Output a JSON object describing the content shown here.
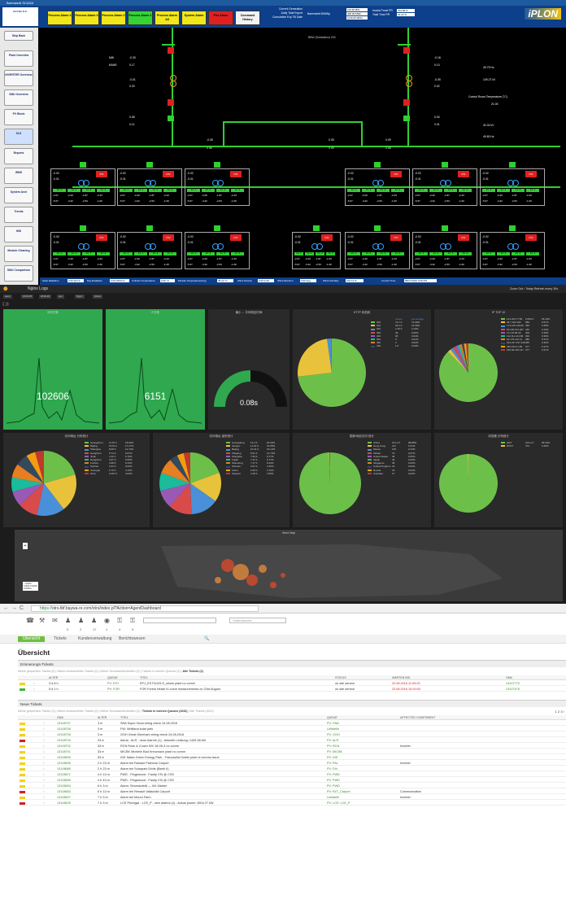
{
  "scada": {
    "title": "Barmstedt SCADA",
    "logo_text": "BAYWA R.E.",
    "alarms": [
      {
        "label": "Process Alarm 4",
        "color": "#f2e61a"
      },
      {
        "label": "Process Alarm 3",
        "color": "#f2e61a"
      },
      {
        "label": "Process Alarm 2",
        "color": "#f2e61a"
      },
      {
        "label": "Process Alarm 1",
        "color": "#35d435"
      },
      {
        "label": "Process Alarm All",
        "color": "#f2e61a"
      },
      {
        "label": "System Alarm",
        "color": "#f2e61a"
      },
      {
        "label": "Fire Alarm",
        "color": "#e02020"
      },
      {
        "label": "Command History",
        "color": "#f2f2f2"
      }
    ],
    "top_info": {
      "l1": "Current Generation",
      "l2": "Daily Total Export",
      "l3": "Cumulative Exp Till Date",
      "mid_label": "Barmstedt 50MWp",
      "f1": "119.48 MW",
      "f2": "468.09 MWh",
      "f3": "1016.05 MWh",
      "r1": "Irradia Panel PR",
      "r2": "Total Time PR",
      "rf1": "794.68 %",
      "rf2": "91.22 %"
    },
    "brand": "iPLON",
    "sidebar": [
      "Skip Back",
      "Plant Overview",
      "INVERTER Overview",
      "SMU Overview",
      "PV Block",
      "SLD",
      "Reports",
      "WMS",
      "System Arch",
      "Trends",
      "MIS",
      "Module Cleaning",
      "SMU Comparison"
    ],
    "feeder": "BBW (Substation) 033",
    "readings": {
      "mw1": "MW",
      "mvar1": "MVAR",
      "v1": "-0.30",
      "v2": "0.17",
      "v3": "-0.01",
      "v4": "0.20",
      "v5": "0.08",
      "v6": "0.11",
      "r1": "-0.18",
      "r2": "0.13",
      "r3": "-0.05",
      "r4": "0.02",
      "r5": "0.00",
      "r6": "0.01",
      "hz1": "49.79 Hz",
      "kv1": "109.27 kV",
      "room": "Control Room Temperature (°C)",
      "roomv": "21.00",
      "kv2": "32.02 kV",
      "hz2": "49.80 Hz",
      "b1": "-0.05",
      "b2": "0.06",
      "b3": "0.05",
      "b4": "0.09",
      "b5": "0.09",
      "b6": "0.06"
    },
    "block": {
      "mw": "-0.02",
      "mvar": "-0.01",
      "btn": "INV",
      "s1": "Inv -1",
      "s2": "Inv -2",
      "s3": "Inv -3",
      "s4": "Inv -4",
      "r1": [
        "-2.07",
        "-2.20",
        "-1.87",
        "-2.43"
      ],
      "r2": [
        "-5.67",
        "-4.32",
        "-2.53",
        "-1.00"
      ],
      "kw": "kW",
      "kvar": "kVAR"
    },
    "bottom": {
      "l1": "Solar Radiation",
      "f1": "0.00 W/m2",
      "l2": "Day Radiation",
      "f2": "0.00 kWh/m2",
      "l3": "Ambient Temperature",
      "f3": "0.00 °C",
      "l4": "Module Temperature(Avg)",
      "f4": "35.22 °C",
      "l5": "Wind Velocity",
      "f5": "0.00 km/h",
      "l6": "Wind Direction",
      "f6": "0.00 deg",
      "l7": "Wind Humidity",
      "f7": "100.12 %",
      "l8": "Current Time",
      "f8": "08/27/2016 3:09 PM"
    }
  },
  "kibana": {
    "app": "Nginx Logs",
    "top_right": "Zoom Out  ›  Today  Refresh every 30s",
    "filters": [
      "www",
      "2016-08",
      "2016-09",
      "ups",
      "Nginx",
      "Active"
    ],
    "section": "汇总",
    "panels": [
      {
        "title": "请求总数",
        "value": "102606"
      },
      {
        "title": "IP总数",
        "value": "6151"
      },
      {
        "title": "最小 ... 平均响应时间",
        "value": "0.08s"
      },
      {
        "title": "HTTP 状态码"
      },
      {
        "title": "IP TOP 10"
      },
      {
        "title": "访问地址 分布统计"
      },
      {
        "title": "访问地址 省份统计"
      },
      {
        "title": "国家/地区访问 统计"
      },
      {
        "title": "浏览器 分布统计"
      },
      {
        "title": "Word Map"
      }
    ],
    "status_legend": {
      "head": [
        "values",
        "percentage"
      ],
      "rows": [
        [
          "200",
          "74.7 K",
          "72.99%"
        ],
        [
          "304",
          "25.2 K",
          "24.59%"
        ],
        [
          "302",
          "2.15 K",
          "2.10%"
        ],
        [
          "499",
          "49",
          "0.05%"
        ],
        [
          "404",
          "36",
          "0.04%"
        ],
        [
          "502",
          "9",
          "0.01%"
        ],
        [
          "499",
          "3",
          "0.00%"
        ],
        [
          "429",
          "1.5",
          "0.00%"
        ]
      ]
    },
    "ip_legend": {
      "rows": [
        [
          "121.224.77.83",
          "2,693 K",
          "26.44%"
        ],
        [
          "36.7.193.182",
          "586",
          "0.57%"
        ],
        [
          "174.145.146.83",
          "490",
          "0.48%"
        ],
        [
          "60.220.131.407",
          "440",
          "0.43%"
        ],
        [
          "171.15.85.36",
          "400",
          "0.39%"
        ],
        [
          "112.111.124.68",
          "394",
          "0.38%"
        ],
        [
          "61.175.110.74",
          "380",
          "0.37%"
        ],
        [
          "222.237.197.248",
          "365",
          "0.36%"
        ],
        [
          "220.194.4.109",
          "377",
          "0.37%"
        ],
        [
          "183.69.135.127",
          "377",
          "0.37%"
        ]
      ]
    },
    "city_legend": {
      "rows": [
        [
          "Guangzhou",
          "11.97 k",
          "18.92%"
        ],
        [
          "Beijing",
          "10.91 k",
          "17.27%"
        ],
        [
          "Shanghai",
          "8.05 K",
          "12.74%"
        ],
        [
          "Hangzhou",
          "5.74 K",
          "9.07%"
        ],
        [
          "Jinan",
          "4.11 K",
          "6.79%"
        ],
        [
          "Hangzhou",
          "4.07 K",
          "6.55%"
        ],
        [
          "Fuzhou",
          "3.68 K",
          "6.33%"
        ],
        [
          "Suzhou",
          "3.41 K",
          "5.63%"
        ],
        [
          "Chengdu",
          "2.76 K",
          "4.16%"
        ],
        [
          "Wuxi",
          "2.297 K",
          "4.03%"
        ]
      ]
    },
    "prov_legend": {
      "rows": [
        [
          "Guangdong",
          "13.4 K",
          "20.03%"
        ],
        [
          "Jiangsu",
          "11.61 K",
          "15.95%"
        ],
        [
          "Beijing",
          "10.41 K",
          "15.13%"
        ],
        [
          "Zhejiang",
          "8.91 K",
          "12.70%"
        ],
        [
          "Shanghai",
          "7.93 K",
          "9.77%"
        ],
        [
          "Fujian",
          "7.47 K",
          "9.77%"
        ],
        [
          "Shandong",
          "7.17 K",
          "8.43%"
        ],
        [
          "Sichuan",
          "3.07 K",
          "4.45%"
        ],
        [
          "Anhui",
          "2.55 K",
          "3.70%"
        ],
        [
          "Shaanxi",
          "2.39 K",
          "3.55%"
        ]
      ]
    },
    "country_legend": {
      "rows": [
        [
          "China",
          "101.3 K",
          "98.88%"
        ],
        [
          "Hong Kong",
          "417",
          "0.41%"
        ],
        [
          "Macau",
          "136",
          "0.13%"
        ],
        [
          "Taiwan",
          "70",
          "0.07%"
        ],
        [
          "United States",
          "46",
          "0.05%"
        ],
        [
          "Japan",
          "40",
          "0.04%"
        ],
        [
          "Singapore",
          "38",
          "0.04%"
        ],
        [
          "United Kingdom",
          "19",
          "0.02%"
        ],
        [
          "Russia",
          "18",
          "0.02%"
        ],
        [
          "Australia",
          "17",
          "0.02%"
        ]
      ]
    },
    "browser_legend": {
      "rows": [
        [
          "GET",
          "102.2 K",
          "99.34%"
        ],
        [
          "POST",
          "474",
          "0.46%"
        ]
      ]
    },
    "map_legend": [
      "> 10000",
      "10000-100000",
      "100000+"
    ]
  },
  "otrs": {
    "url": "https://otrs-tbf.baywa-re.com/otrs/index.pl?Action=AgentDashboard",
    "url_https": "https://",
    "url_rest": "otrs-tbf.baywa-re.com/otrs/index.pl?Action=AgentDashboard",
    "counts": [
      "0",
      "2",
      "17",
      "1",
      "4",
      "9"
    ],
    "fulltext": "Volltextsuche",
    "tabs": [
      "Übersicht",
      "Tickets",
      "Kundenverwaltung",
      "Berichtswesen"
    ],
    "heading": "Übersicht",
    "reminder": {
      "title": "Erinnerungs-Tickets",
      "filters_pre": "Meine gesperrten Tickets (0) | Meine beobachteten Tickets (0) | Meine Verantwortlichkeiten (0) | Tickets in meinen Queues (2) | ",
      "filters_bold": "Alle Tickets (2)",
      "cols": [
        "ALTER",
        "QUEUE",
        "TITEL",
        "STATUS",
        "WARTEN BIS",
        "OM#"
      ],
      "rows": [
        {
          "age": "3 d 8 h",
          "queue": "PV: EPJ",
          "title": "EPJ_ES PUJOLS_whole plant no comm",
          "status": "on site service",
          "wait": "22.08.2016 11:05:00",
          "om": "13107770",
          "pri": "#f2d21a"
        },
        {
          "age": "5 d 1 h",
          "queue": "PV: FOR",
          "title": "FOR Forest Heath IV-curve measurements on 23rd August",
          "status": "on site service",
          "wait": "23.08.2016 10:00:00",
          "om": "13107476",
          "pri": "#3fb53f"
        }
      ]
    },
    "new": {
      "title": "Neue Tickets",
      "filters_pre": "Meine gesperrten Tickets (3) | Meine beobachteten Tickets (0) | Meine Verantwortlichkeiten (0) | ",
      "filters_bold": "Tickets in meinen Queues (1032)",
      "filters_post": " | Alle Tickets (3012)",
      "pager": "1 2 3 ›",
      "cols": [
        "OM#",
        "ALTER",
        "TITEL",
        "QUEUE",
        "AFFECTED COMPONENT"
      ],
      "rows": [
        {
          "om": "13108707",
          "age": "3 m",
          "title": "SNA Super Nova string check 24.08.2016",
          "queue": "PV: SNA",
          "comp": "",
          "pri": "#f2d21a"
        },
        {
          "om": "13108706",
          "age": "3 m",
          "title": "FW: Whitland solar park",
          "queue": "Leitstelle",
          "comp": "",
          "pri": "#f2d21a"
        },
        {
          "om": "13108705",
          "age": "3 m",
          "title": "GGH Great Glemham string check 24.08.2016",
          "queue": "PV: GGH",
          "comp": "",
          "pri": "#f2d21a"
        },
        {
          "om": "13108703",
          "age": "23 m",
          "title": "Aleria - ALR - neue Alarme (1) - Aktuelle Leistung: 1425.38 kW",
          "queue": "PV: ALR",
          "comp": "",
          "pri": "#d02020"
        },
        {
          "om": "13108702",
          "age": "33 m",
          "title": "RCN Rose & Crown INV 18-05-3 no comm",
          "queue": "PV: RCN",
          "comp": "Inverter",
          "pri": "#f2d21a"
        },
        {
          "om": "13108701",
          "age": "33 m",
          "title": "MICBK Michelin Bad Kreuznach plant no comm",
          "queue": "PV: MICBK",
          "comp": "",
          "pri": "#f2d21a"
        },
        {
          "om": "13108699",
          "age": "53 m",
          "title": "IGE Italian Green Energy Park - Francavilla-Soleto plant oi comms issue",
          "queue": "PV: IGE",
          "comp": "",
          "pri": "#f2d21a"
        },
        {
          "om": "13108696",
          "age": "2 h 23 m",
          "title": "Alarm bei Ranault Palencia Carport",
          "queue": "PV: PAL",
          "comp": "Inverter",
          "pri": "#f2d21a"
        },
        {
          "om": "13108685",
          "age": "2 h 23 m",
          "title": "Alarm bei Solarpark Divitz (Barth II)",
          "queue": "PV: DIV",
          "comp": "",
          "pri": "#f2d21a"
        },
        {
          "om": "13108671",
          "age": "4 h 13 m",
          "title": "PWD - Pingewood - Faulty VTs @ CSS",
          "queue": "PV: PWD",
          "comp": "",
          "pri": "#f2d21a"
        },
        {
          "om": "13108665",
          "age": "4 h 43 m",
          "title": "PWD - Pingewood - Faulty VTs @ CSS",
          "queue": "PV: PWD",
          "comp": "",
          "pri": "#f2d21a"
        },
        {
          "om": "13108654",
          "age": "6 h 3 m",
          "title": "Alarm: Stromausfall — WL Master",
          "queue": "PV: PWD",
          "comp": "",
          "pri": "#f2d21a"
        },
        {
          "om": "13108653",
          "age": "6 h 13 m",
          "title": "Alarm bei Renault Valladolid Carport",
          "queue": "PV: RLT_Carport",
          "comp": "Communication",
          "pri": "#d02020"
        },
        {
          "om": "13108627",
          "age": "7 h 3 m",
          "title": "Alarm bei Mount Farm",
          "queue": "Leitstelle",
          "comp": "Inverter",
          "pri": "#f2d21a"
        },
        {
          "om": "13108625",
          "age": "7 h 3 m",
          "title": "LCE Peichgat - LCE_P - new alarms (4) - Actual power: 4504.27 kW",
          "queue": "PV: LCE: LCE_P",
          "comp": "",
          "pri": "#d02020"
        }
      ]
    }
  }
}
